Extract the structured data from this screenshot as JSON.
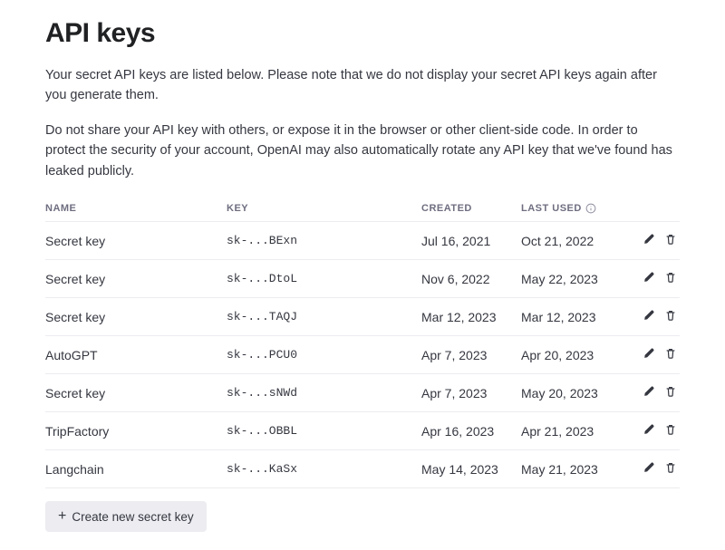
{
  "page": {
    "title": "API keys",
    "intro1": "Your secret API keys are listed below. Please note that we do not display your secret API keys again after you generate them.",
    "intro2": "Do not share your API key with others, or expose it in the browser or other client-side code. In order to protect the security of your account, OpenAI may also automatically rotate any API key that we've found has leaked publicly."
  },
  "table": {
    "headers": {
      "name": "NAME",
      "key": "KEY",
      "created": "CREATED",
      "lastused": "LAST USED"
    },
    "rows": [
      {
        "name": "Secret key",
        "key": "sk-...BExn",
        "created": "Jul 16, 2021",
        "lastused": "Oct 21, 2022"
      },
      {
        "name": "Secret key",
        "key": "sk-...DtoL",
        "created": "Nov 6, 2022",
        "lastused": "May 22, 2023"
      },
      {
        "name": "Secret key",
        "key": "sk-...TAQJ",
        "created": "Mar 12, 2023",
        "lastused": "Mar 12, 2023"
      },
      {
        "name": "AutoGPT",
        "key": "sk-...PCU0",
        "created": "Apr 7, 2023",
        "lastused": "Apr 20, 2023"
      },
      {
        "name": "Secret key",
        "key": "sk-...sNWd",
        "created": "Apr 7, 2023",
        "lastused": "May 20, 2023"
      },
      {
        "name": "TripFactory",
        "key": "sk-...OBBL",
        "created": "Apr 16, 2023",
        "lastused": "Apr 21, 2023"
      },
      {
        "name": "Langchain",
        "key": "sk-...KaSx",
        "created": "May 14, 2023",
        "lastused": "May 21, 2023"
      }
    ]
  },
  "actions": {
    "create_label": "Create new secret key"
  }
}
